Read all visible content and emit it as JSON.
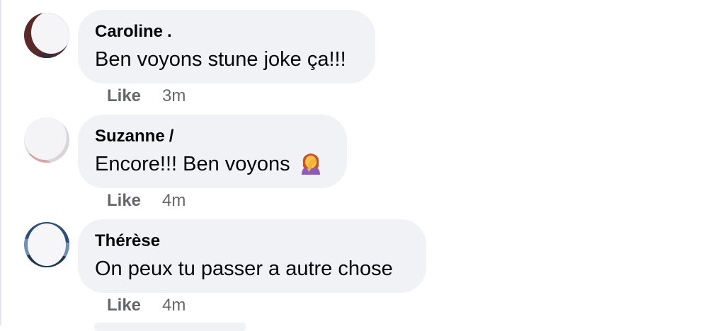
{
  "colors": {
    "bubble_bg": "#f0f2f5",
    "text": "#050505",
    "meta_text": "#65676b"
  },
  "comments": [
    {
      "author": "Caroline",
      "author_trail": ".",
      "text": "Ben voyons stune joke ça!!!",
      "like_label": "Like",
      "time": "3m"
    },
    {
      "author": "Suzanne",
      "author_trail": "/",
      "text": "Encore!!! Ben voyons",
      "emoji_icon": "woman-facepalming-icon",
      "like_label": "Like",
      "time": "4m"
    },
    {
      "author": "Thérèse",
      "text": "On peux tu passer a autre chose",
      "like_label": "Like",
      "time": "4m"
    }
  ]
}
